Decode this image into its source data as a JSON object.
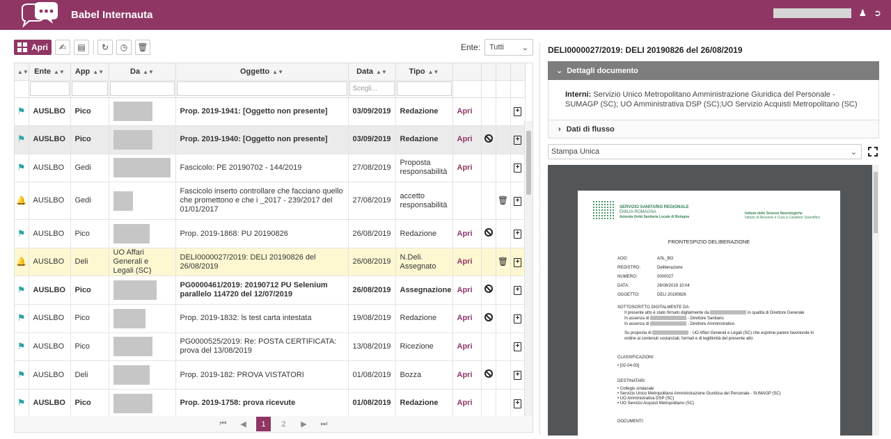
{
  "header": {
    "app_title": "Babel Internauta",
    "colors": {
      "brand": "#8f3665",
      "flag": "#2ba3a1",
      "highlight_row": "#fdf8d2"
    },
    "icons": [
      "user-icon",
      "logout-icon"
    ]
  },
  "toolbar": {
    "open_label": "Apri",
    "icons": [
      "sign-icon",
      "stamp-icon",
      "refresh-icon",
      "history-icon",
      "trash-icon"
    ],
    "ente_label": "Ente:",
    "ente_value": "Tutti"
  },
  "table": {
    "columns": [
      "Ente",
      "App",
      "Da",
      "Oggetto",
      "Data",
      "Tipo"
    ],
    "data_filter_placeholder": "Scegli...",
    "rows": [
      {
        "icon": "flag",
        "ente": "AUSLBO",
        "app": "Pico",
        "da": "",
        "oggetto": "Prop. 2019-1941: [Oggetto non presente]",
        "data": "03/09/2019",
        "tipo": "Redazione",
        "apri": "Apri",
        "ban": false,
        "trash": false
      },
      {
        "icon": "flag",
        "ente": "AUSLBO",
        "app": "Pico",
        "da": "",
        "oggetto": "Prop. 2019-1940: [Oggetto non presente]",
        "data": "03/09/2019",
        "tipo": "Redazione",
        "apri": "Apri",
        "ban": true,
        "trash": false
      },
      {
        "icon": "flag",
        "ente": "AUSLBO",
        "app": "Gedi",
        "da": "",
        "oggetto": "Fascicolo: PE 20190702 - 144/2019",
        "data": "27/08/2019",
        "tipo": "Proposta responsabilità",
        "apri": "Apri",
        "ban": false,
        "trash": false
      },
      {
        "icon": "bell",
        "ente": "AUSLBO",
        "app": "Gedi",
        "da": "",
        "oggetto": "Fascicolo inserto controllare che facciano quello che promettono e che i _2017 - 239/2017 del 01/01/2017",
        "data": "27/08/2019",
        "tipo": "accetto responsabilità",
        "apri": "",
        "ban": false,
        "trash": true
      },
      {
        "icon": "flag",
        "ente": "AUSLBO",
        "app": "Pico",
        "da": "",
        "oggetto": "Prop. 2019-1868: PU 20190826",
        "data": "26/08/2019",
        "tipo": "Redazione",
        "apri": "Apri",
        "ban": true,
        "trash": false
      },
      {
        "icon": "bell",
        "ente": "AUSLBO",
        "app": "Deli",
        "da": "UO Affari Generali e Legali (SC)",
        "oggetto": "DELI0000027/2019: DELI 20190826 del 26/08/2019",
        "data": "26/08/2019",
        "tipo": "N.Deli. Assegnato",
        "apri": "Apri",
        "ban": false,
        "trash": true
      },
      {
        "icon": "flag",
        "ente": "AUSLBO",
        "app": "Pico",
        "da": "",
        "oggetto": "PG0000461/2019: 20190712 PU Selenium parallelo 114720 del 12/07/2019",
        "data": "26/08/2019",
        "tipo": "Assegnazione",
        "apri": "Apri",
        "ban": true,
        "trash": false
      },
      {
        "icon": "flag",
        "ente": "AUSLBO",
        "app": "Pico",
        "da": "",
        "oggetto": "Prop. 2019-1832: ls test carta intestata",
        "data": "19/08/2019",
        "tipo": "Redazione",
        "apri": "Apri",
        "ban": true,
        "trash": false
      },
      {
        "icon": "flag",
        "ente": "AUSLBO",
        "app": "Pico",
        "da": "",
        "oggetto": "PG0000525/2019: Re: POSTA CERTIFICATA: prova del 13/08/2019",
        "data": "13/08/2019",
        "tipo": "Ricezione",
        "apri": "Apri",
        "ban": false,
        "trash": false
      },
      {
        "icon": "flag",
        "ente": "AUSLBO",
        "app": "Deli",
        "da": "",
        "oggetto": "Prop. 2019-182: PROVA VISTATORI",
        "data": "01/08/2019",
        "tipo": "Bozza",
        "apri": "Apri",
        "ban": true,
        "trash": false
      },
      {
        "icon": "flag",
        "ente": "AUSLBO",
        "app": "Pico",
        "da": "",
        "oggetto": "Prop. 2019-1758: prova ricevute",
        "data": "01/08/2019",
        "tipo": "Redazione",
        "apri": "Apri",
        "ban": false,
        "trash": false
      }
    ]
  },
  "pager": {
    "pages": [
      "1",
      "2"
    ],
    "current": "1"
  },
  "detail": {
    "title": "DELI0000027/2019: DELI 20190826 del 26/08/2019",
    "section1": "Dettagli documento",
    "interni_label": "Interni:",
    "interni_value": "Servizio Unico Metropolitano Amministrazione Giuridica del Personale - SUMAGP (SC); UO Amministrativa DSP (SC);UO Servizio Acquisti Metropolitano (SC)",
    "section2": "Dati di flusso",
    "print_select": "Stampa Unica"
  },
  "pdf": {
    "org_line1": "SERVIZIO SANITARIO REGIONALE",
    "org_line2": "EMILIA-ROMAGNA",
    "org_line3": "Azienda Unità Sanitaria Locale di Bologna",
    "org_right1": "Istituto delle Scienze Neurologiche",
    "org_right2": "Istituto di Ricovero e Cura a Carattere Scientifico",
    "heading": "FRONTESPIZIO DELIBERAZIONE",
    "fields": [
      {
        "k": "AOO:",
        "v": "ASL_BO"
      },
      {
        "k": "REGISTRO:",
        "v": "Deliberazione"
      },
      {
        "k": "NUMERO:",
        "v": "0000027"
      },
      {
        "k": "DATA:",
        "v": "26/08/2019 10:04"
      },
      {
        "k": "OGGETTO:",
        "v": "DELI 20190826"
      }
    ],
    "sott_title": "SOTTOSCRITTO DIGITALMENTE DA:",
    "sott_1a": "Il presente atto è stato firmato digitalmente da",
    "sott_1b": "in qualità di Direttore Generale",
    "sott_2a": "In assenza di",
    "sott_2b": "- Direttore Sanitario",
    "sott_3a": "In assenza di",
    "sott_3b": "- Direttore Amministrativo",
    "proposta_a": "Su proposta di",
    "proposta_b": "- UO Affari Generali e Legali (SC) che esprime parere favorevole in ordine ai contenuti sostanziali, formali e di legittimità del presente atto",
    "class_title": "CLASSIFICAZIONI:",
    "class_item": "[02-04-03]",
    "dest_title": "DESTINATARI:",
    "dest_items": [
      "Collegio sindacale",
      "Servizio Unico Metropolitano Amministrazione Giuridica del Personale - SUMAGP (SC)",
      "UO Amministrativa DSP (SC)",
      "UO Servizio Acquisti Metropolitano (SC)"
    ],
    "docs_title": "DOCUMENTI:"
  }
}
